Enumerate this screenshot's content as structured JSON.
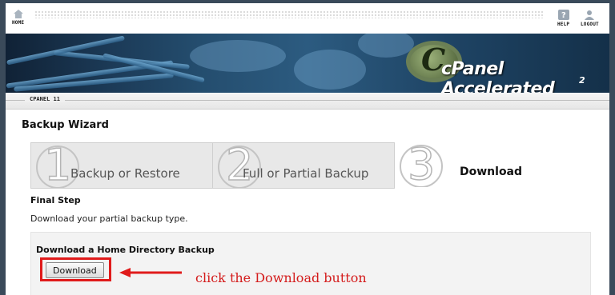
{
  "nav": {
    "home_label": "HOME",
    "help_label": "HELP",
    "logout_label": "LOGOUT"
  },
  "banner": {
    "logo_prefix": "cPanel",
    "logo_suffix": "Accelerated",
    "logo_version": "2"
  },
  "strip": {
    "label": "CPANEL 11"
  },
  "wizard": {
    "title": "Backup Wizard",
    "steps": [
      {
        "number": "1",
        "label": "Backup or Restore"
      },
      {
        "number": "2",
        "label": "Full or Partial Backup"
      },
      {
        "number": "3",
        "label": "Download"
      }
    ],
    "final_step": "Final Step",
    "description": "Download your partial backup type."
  },
  "download_section": {
    "title": "Download a Home Directory Backup",
    "button_label": "Download"
  },
  "annotation": {
    "text": "click the Download button",
    "color": "#d41c1c"
  }
}
